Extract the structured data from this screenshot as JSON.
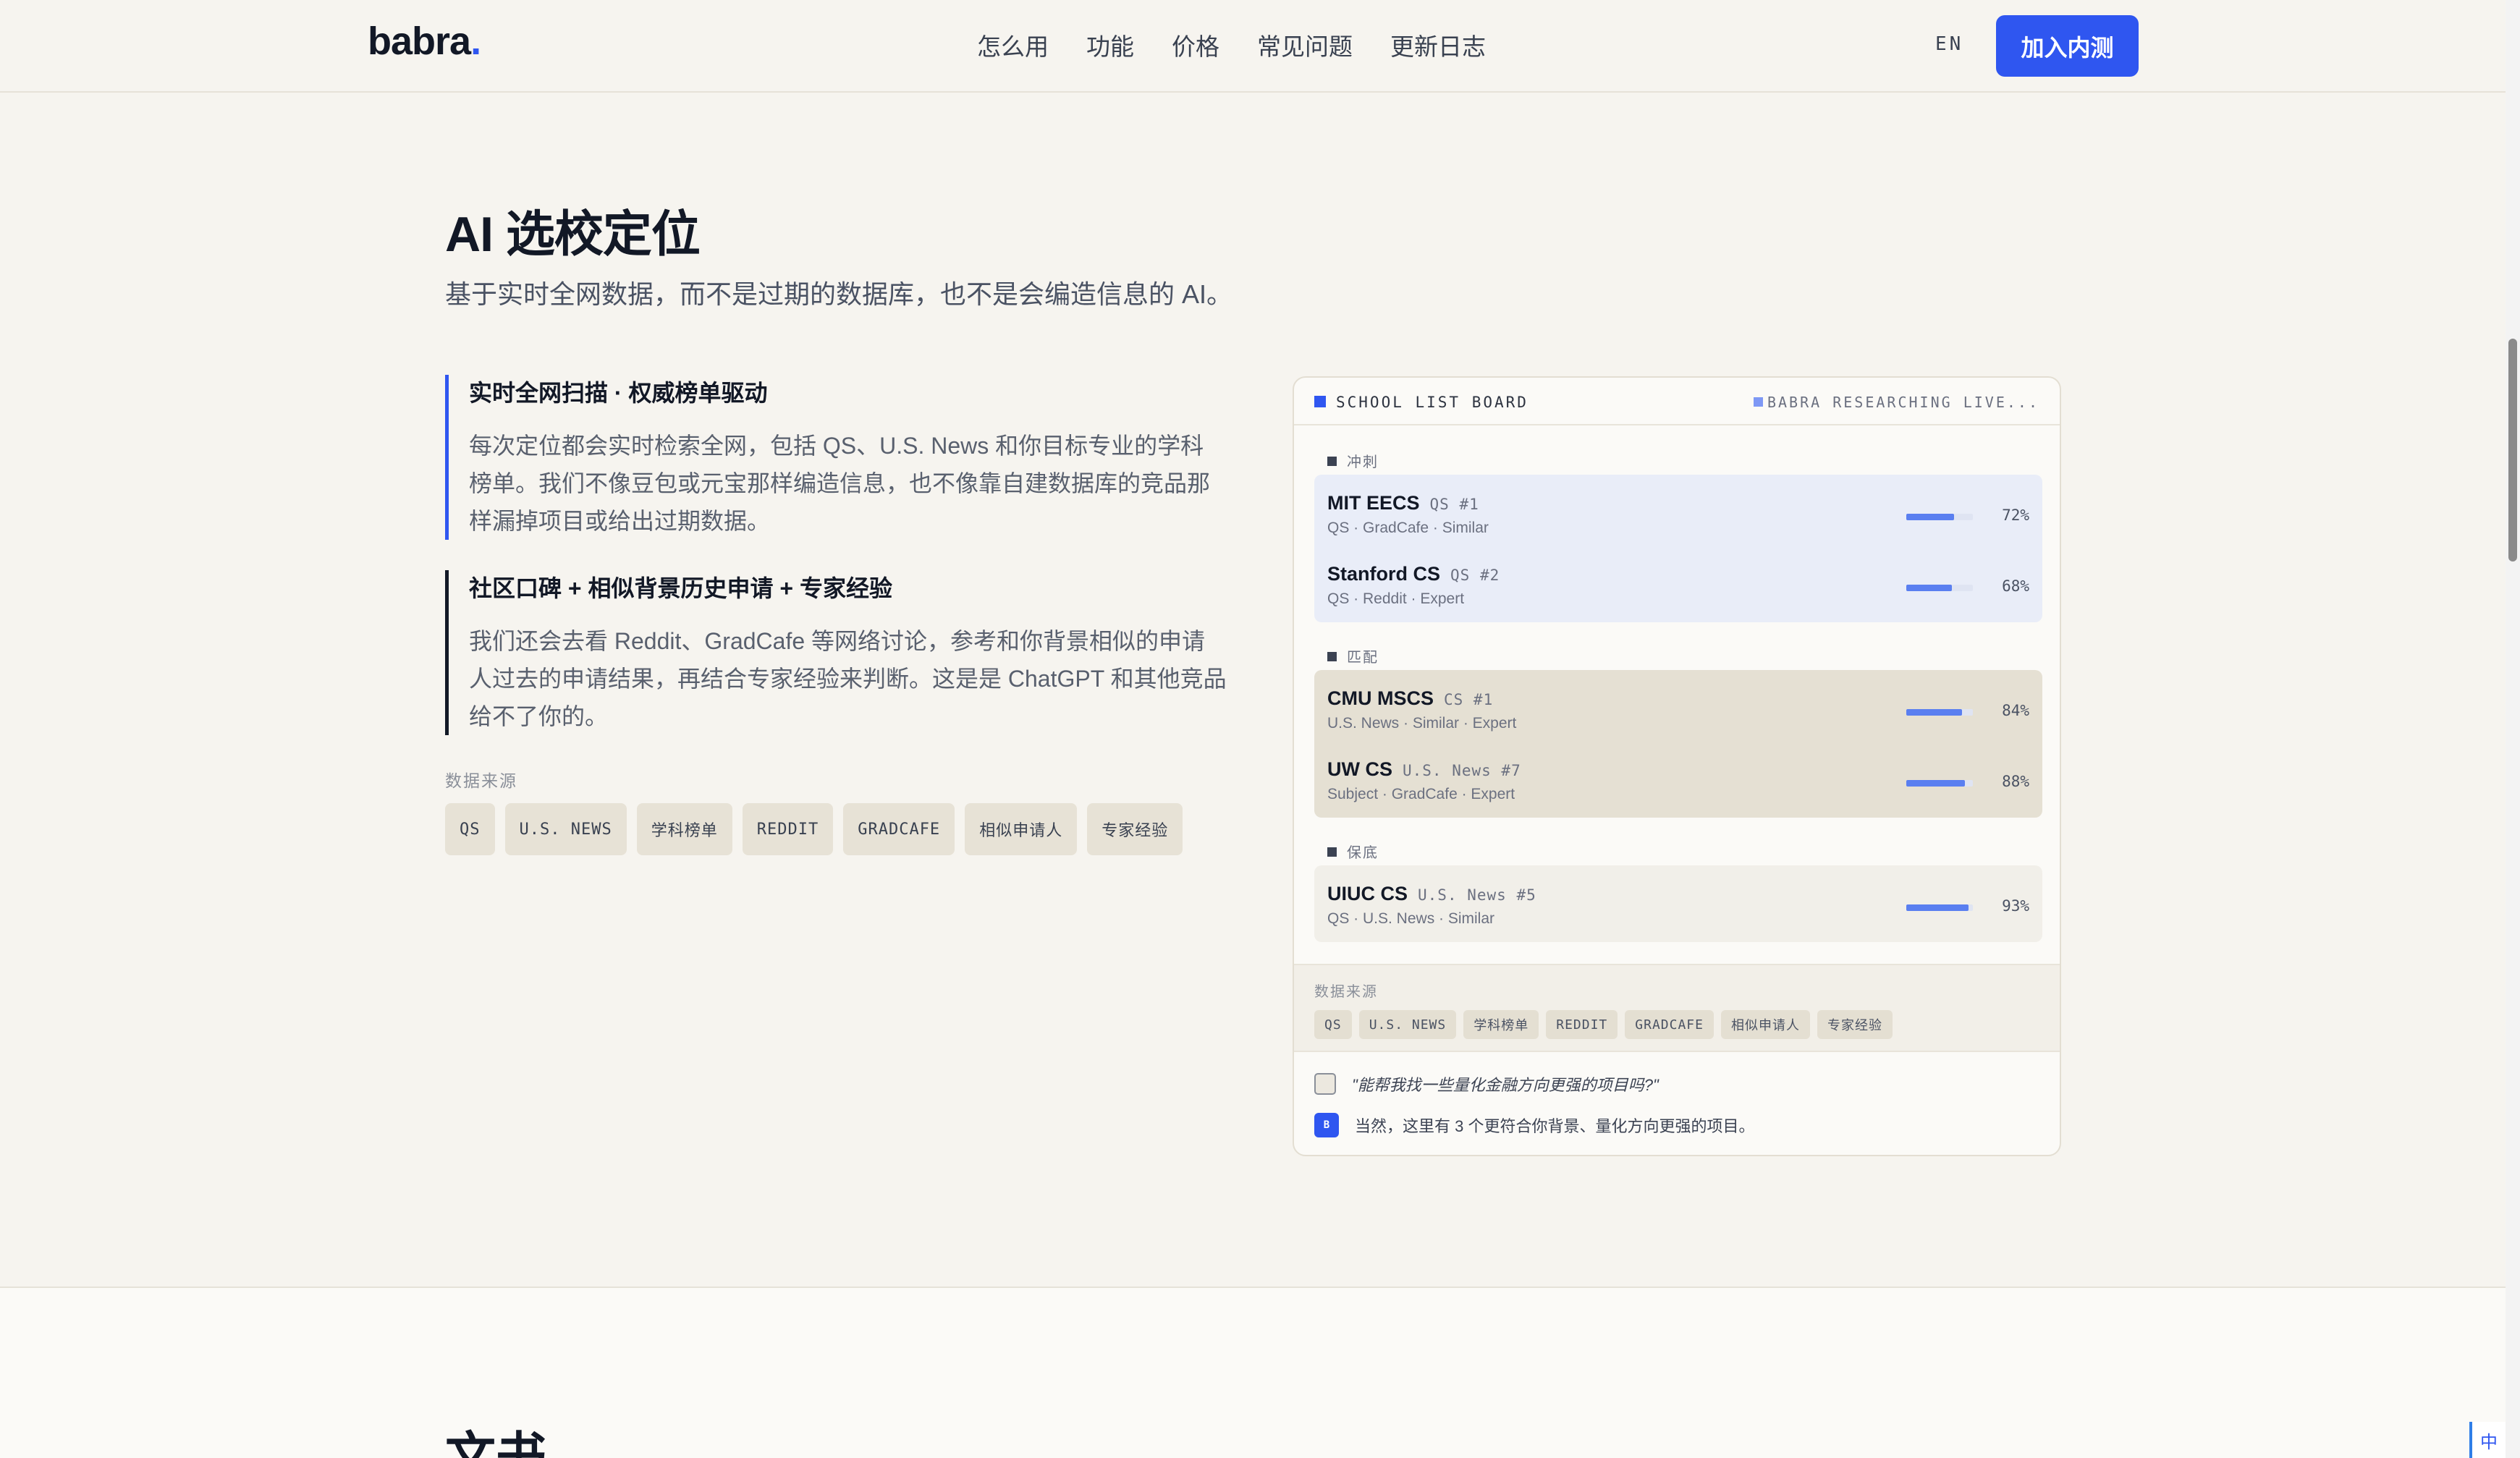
{
  "header": {
    "logo": "babra",
    "logo_dot": ".",
    "nav": [
      "怎么用",
      "功能",
      "价格",
      "常见问题",
      "更新日志"
    ],
    "lang": "EN",
    "cta": "加入内测"
  },
  "section": {
    "title": "AI 选校定位",
    "subtitle": "基于实时全网数据，而不是过期的数据库，也不是会编造信息的 AI。",
    "features": [
      {
        "title": "实时全网扫描 · 权威榜单驱动",
        "desc": "每次定位都会实时检索全网，包括 QS、U.S. News 和你目标专业的学科榜单。我们不像豆包或元宝那样编造信息，也不像靠自建数据库的竞品那样漏掉项目或给出过期数据。"
      },
      {
        "title": "社区口碑 + 相似背景历史申请 + 专家经验",
        "desc": "我们还会去看 Reddit、GradCafe 等网络讨论，参考和你背景相似的申请人过去的申请结果，再结合专家经验来判断。这是是 ChatGPT 和其他竞品给不了你的。"
      }
    ],
    "sources_label": "数据来源",
    "sources": [
      "QS",
      "U.S. NEWS",
      "学科榜单",
      "REDDIT",
      "GRADCAFE",
      "相似申请人",
      "专家经验"
    ]
  },
  "board": {
    "title": "SCHOOL LIST BOARD",
    "live": "BABRA RESEARCHING LIVE...",
    "groups": [
      {
        "label": "冲刺",
        "rows": [
          {
            "name": "MIT EECS",
            "rank": "QS #1",
            "src": "QS · GradCafe · Similar",
            "pct": "72%",
            "value": 0.72
          },
          {
            "name": "Stanford CS",
            "rank": "QS #2",
            "src": "QS · Reddit · Expert",
            "pct": "68%",
            "value": 0.68
          }
        ]
      },
      {
        "label": "匹配",
        "rows": [
          {
            "name": "CMU MSCS",
            "rank": "CS #1",
            "src": "U.S. News · Similar · Expert",
            "pct": "84%",
            "value": 0.84
          },
          {
            "name": "UW CS",
            "rank": "U.S. News #7",
            "src": "Subject · GradCafe · Expert",
            "pct": "88%",
            "value": 0.88
          }
        ]
      },
      {
        "label": "保底",
        "rows": [
          {
            "name": "UIUC CS",
            "rank": "U.S. News #5",
            "src": "QS · U.S. News · Similar",
            "pct": "93%",
            "value": 0.93
          }
        ]
      }
    ],
    "sources_label": "数据来源",
    "sources": [
      "QS",
      "U.S. NEWS",
      "学科榜单",
      "REDDIT",
      "GRADCAFE",
      "相似申请人",
      "专家经验"
    ],
    "chat_question": "\"能帮我找一些量化金融方向更强的项目吗?\"",
    "chat_answer_badge": "B",
    "chat_answer": "当然，这里有 3 个更符合你背景、量化方向更强的项目。"
  },
  "next_section": {
    "title": "文书"
  },
  "ime": "中",
  "colors": {
    "accent": "#2f56f0",
    "background": "#f6f4ef",
    "reach_bg": "#e9edf8",
    "match_bg": "#e5e0d3"
  }
}
